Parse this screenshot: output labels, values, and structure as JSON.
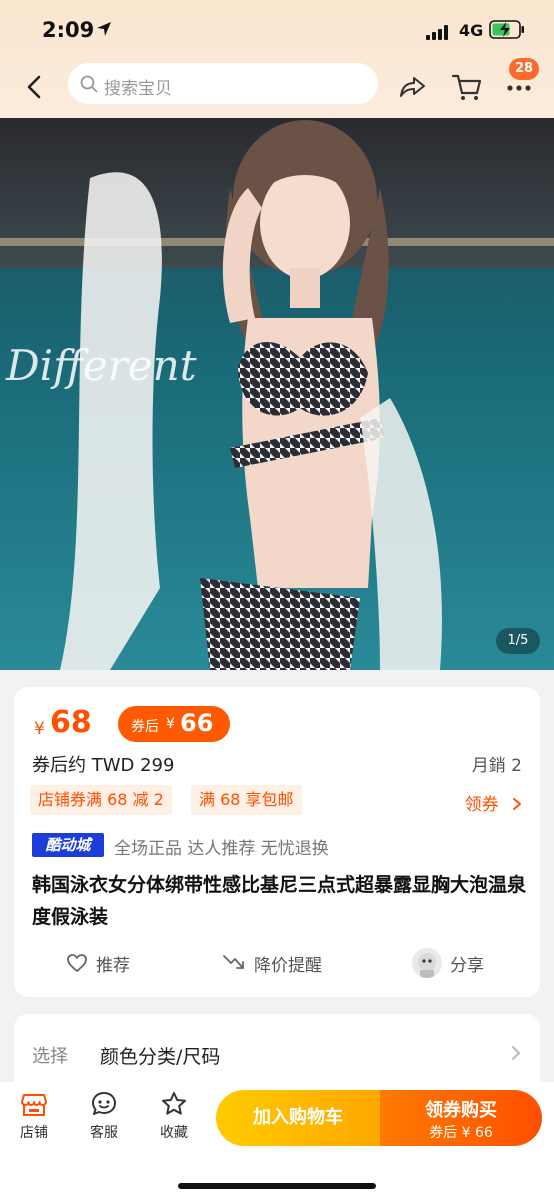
{
  "status_bar": {
    "time": "2:09",
    "network": "4G"
  },
  "header": {
    "search_placeholder": "搜索宝贝",
    "badge_count": "28"
  },
  "hero": {
    "image_caption": "Different",
    "counter": "1/5"
  },
  "product": {
    "currency_symbol": "¥",
    "price": "68",
    "coupon_label": "券后",
    "coupon_currency": "¥",
    "coupon_price": "66",
    "twd_price": "券后约 TWD 299",
    "monthly_sales": "月銷 2",
    "tags": [
      "店铺券满 68 减 2",
      "满 68 享包邮"
    ],
    "claim_coupon": "领券",
    "brand_logo": "酷动城",
    "guarantees": "全场正品  达人推荐  无忧退换",
    "title": "韩国泳衣女分体绑带性感比基尼三点式超暴露显胸大泡温泉度假泳装",
    "actions": {
      "recommend": "推荐",
      "price_alert": "降价提醒",
      "share": "分享"
    }
  },
  "select": {
    "label": "选择",
    "value": "颜色分类/尺码"
  },
  "bottom_bar": {
    "store": "店铺",
    "service": "客服",
    "favorite": "收藏",
    "add_to_cart": "加入购物车",
    "buy_label": "领券购买",
    "buy_sub": "券后 ¥ 66"
  },
  "colors": {
    "accent": "#ff4f00",
    "cart_yellow": "#ffb400",
    "brand_blue": "#1b3ed8"
  }
}
